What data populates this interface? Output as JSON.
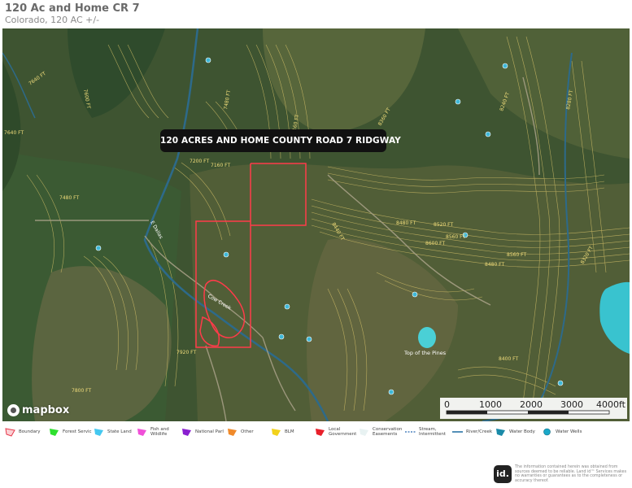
{
  "header": {
    "title": "120 Ac and Home CR 7",
    "subtitle": "Colorado, 120 AC +/-"
  },
  "map": {
    "banner": "120 ACRES AND HOME COUNTY ROAD 7 RIDGWAY",
    "attribution": "mapbox",
    "contour_labels": [
      "7640 FT",
      "7600 FT",
      "7640 FT",
      "7480 FT",
      "7160 FT",
      "7200 FT",
      "7480 FT",
      "8160 FT",
      "8240 FT",
      "8360 FT",
      "8440 FT",
      "8480 FT",
      "8520 FT",
      "8560 FT",
      "8600 FT",
      "8560 FT",
      "8480 FT",
      "7920 FT",
      "7800 FT",
      "8280 FT",
      "8320 FT",
      "8400 FT"
    ],
    "road_labels": [
      "Cow Creek",
      "E Dallas"
    ],
    "places": [
      "Top of the Pines"
    ],
    "scalebar": {
      "ticks": [
        "0",
        "1000",
        "2000",
        "3000",
        "4000ft"
      ]
    }
  },
  "legend": [
    {
      "label": "Boundary",
      "color": "#e6394b",
      "shape": "boundary"
    },
    {
      "label": "Forest Servic",
      "color": "#2ee02e",
      "shape": "poly"
    },
    {
      "label": "State Land",
      "color": "#44c8f0",
      "shape": "poly"
    },
    {
      "label": "Fish and Wildlife",
      "color": "#f050d8",
      "shape": "poly"
    },
    {
      "label": "National Parl",
      "color": "#8a1fd0",
      "shape": "poly"
    },
    {
      "label": "Other",
      "color": "#f08a2a",
      "shape": "poly"
    },
    {
      "label": "BLM",
      "color": "#f2d21c",
      "shape": "poly"
    },
    {
      "label": "Local Government",
      "color": "#e8202a",
      "shape": "poly"
    },
    {
      "label": "Conservation Easements",
      "color": "#e8f2f2",
      "shape": "poly"
    },
    {
      "label": "Stream, Intermittent",
      "color": "#2a6ab0",
      "shape": "dash"
    },
    {
      "label": "River/Creek",
      "color": "#1a6aa0",
      "shape": "line"
    },
    {
      "label": "Water Body",
      "color": "#1a8aa8",
      "shape": "poly"
    },
    {
      "label": "Water Wells",
      "color": "#1aa8c8",
      "shape": "dot"
    }
  ],
  "footer": {
    "logo_text": "id.",
    "disclaimer": "The information contained herein was obtained from sources deemed to be reliable. Land id™ Services makes no warranties or guarantees as to the completeness or accuracy thereof."
  }
}
